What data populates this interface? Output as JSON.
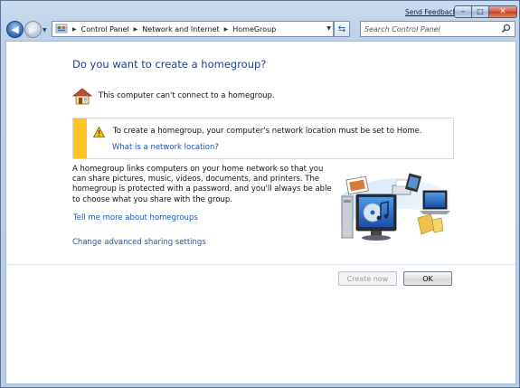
{
  "window": {
    "send_feedback": "Send Feedback",
    "caption": {
      "minimize": "–",
      "maximize": "□",
      "close": "✕"
    }
  },
  "nav": {
    "back_icon": "back-arrow-icon",
    "forward_icon": "forward-arrow-icon",
    "breadcrumbs": [
      "Control Panel",
      "Network and Internet",
      "HomeGroup"
    ],
    "search_placeholder": "Search Control Panel"
  },
  "main": {
    "title": "Do you want to create a homegroup?",
    "status_text": "This computer can't connect to a homegroup.",
    "warning": {
      "text": "To create a homegroup, your computer's network location must be set to Home.",
      "link": "What is a network location?"
    },
    "description": "A homegroup links computers on your home network so that you can share pictures, music, videos, documents, and printers. The homegroup is protected with a password, and you'll always be able to choose what you share with the group.",
    "links": {
      "tell_me_more": "Tell me more about homegroups",
      "advanced_sharing": "Change advanced sharing settings"
    }
  },
  "buttons": {
    "create_now": "Create now",
    "ok": "OK"
  },
  "colors": {
    "title": "#1e3f8f",
    "link": "#1b56b5",
    "warning_stripe": "#ffc422",
    "frame": "#bcd1ea"
  }
}
